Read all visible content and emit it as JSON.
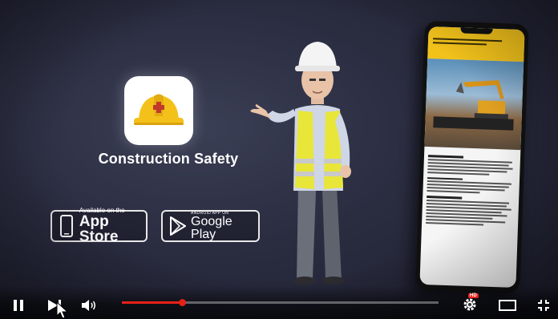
{
  "app": {
    "title": "Construction Safety"
  },
  "badges": {
    "apple": {
      "small": "Available on the",
      "big": "App Store"
    },
    "google": {
      "small": "ANDROID APP ON",
      "big": "Google Play"
    }
  },
  "player": {
    "progress": 0.19,
    "hd_label": "HD",
    "colors": {
      "accent": "#e62117",
      "brand_yellow": "#f2c21b"
    }
  },
  "icons": [
    "pause-icon",
    "next-icon",
    "volume-icon",
    "settings-icon",
    "theater-mode-icon",
    "exit-fullscreen-icon",
    "cursor-icon"
  ]
}
